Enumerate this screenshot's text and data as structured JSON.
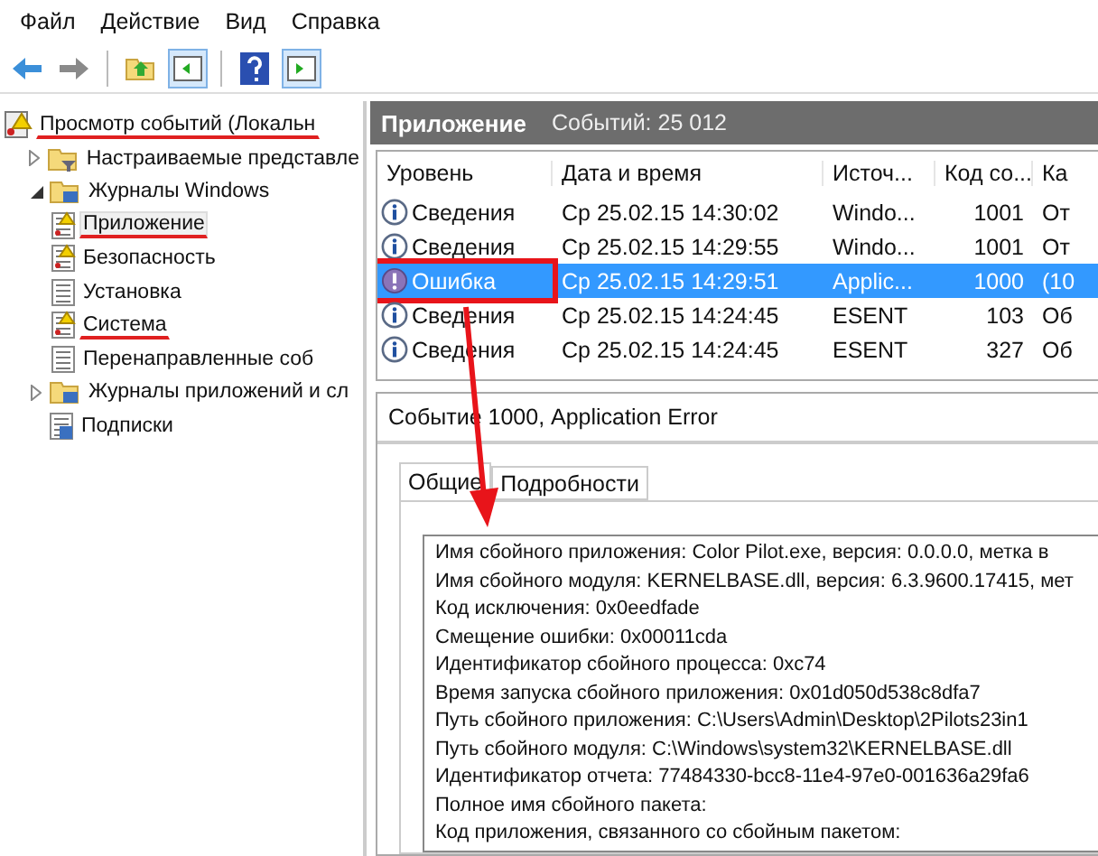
{
  "menu": [
    "Файл",
    "Действие",
    "Вид",
    "Справка"
  ],
  "tree": {
    "label": "Просмотр событий (Локальн",
    "underlined": true,
    "children": [
      {
        "label": "Настраиваемые представле",
        "kind": "filter-folder",
        "expanded": false
      },
      {
        "label": "Журналы Windows",
        "kind": "folder",
        "expanded": true,
        "children": [
          {
            "label": "Приложение",
            "kind": "log",
            "selected": true,
            "underlined": true
          },
          {
            "label": "Безопасность",
            "kind": "log",
            "selected": false,
            "underlined": false
          },
          {
            "label": "Установка",
            "kind": "plain",
            "selected": false,
            "underlined": false
          },
          {
            "label": "Система",
            "kind": "log",
            "selected": false,
            "underlined": true
          },
          {
            "label": "Перенаправленные соб",
            "kind": "plain",
            "selected": false,
            "underlined": false
          }
        ]
      },
      {
        "label": "Журналы приложений и сл",
        "kind": "folder",
        "expanded": false
      },
      {
        "label": "Подписки",
        "kind": "subs"
      }
    ]
  },
  "header": {
    "title": "Приложение",
    "count": "Событий: 25 012"
  },
  "table": {
    "columns": [
      "Уровень",
      "Дата и время",
      "Источ...",
      "Код со...",
      "Ка"
    ],
    "rows": [
      {
        "kind": "info",
        "level": "Сведения",
        "date": "Ср 25.02.15 14:30:02",
        "source": "Windo...",
        "code": "1001",
        "column_5": "От",
        "selected": false,
        "boxed": false
      },
      {
        "kind": "info",
        "level": "Сведения",
        "date": "Ср 25.02.15 14:29:55",
        "source": "Windo...",
        "code": "1001",
        "column_5": "От",
        "selected": false,
        "boxed": false
      },
      {
        "kind": "error",
        "level": "Ошибка",
        "date": "Ср 25.02.15 14:29:51",
        "source": "Applic...",
        "code": "1000",
        "column_5": "(10",
        "selected": true,
        "boxed": true
      },
      {
        "kind": "info",
        "level": "Сведения",
        "date": "Ср 25.02.15 14:24:45",
        "source": "ESENT",
        "code": "103",
        "column_5": "Об",
        "selected": false,
        "boxed": false
      },
      {
        "kind": "info",
        "level": "Сведения",
        "date": "Ср 25.02.15 14:24:45",
        "source": "ESENT",
        "code": "327",
        "column_5": "Об",
        "selected": false,
        "boxed": false
      }
    ]
  },
  "details": {
    "title": "Событие 1000, Application Error",
    "tabs": [
      {
        "label": "Общие",
        "selected": true
      },
      {
        "label": "Подробности",
        "selected": false
      }
    ],
    "lines": [
      {
        "text": "Имя сбойного приложения: Color Pilot.exe, версия: 0.0.0.0, метка в"
      },
      {
        "text": "Имя сбойного модуля: KERNELBASE.dll, версия: 6.3.9600.17415, мет"
      },
      {
        "text": "Код исключения: 0x0eedfade"
      },
      {
        "text": "Смещение ошибки: 0x00011cda"
      },
      {
        "text": "Идентификатор сбойного процесса: 0xc74"
      },
      {
        "text": "Время запуска сбойного приложения: 0x01d050d538c8dfa7"
      },
      {
        "text": "Путь сбойного приложения: C:\\Users\\Admin\\Desktop\\2Pilots23in1"
      },
      {
        "text": "Путь сбойного модуля: C:\\Windows\\system32\\KERNELBASE.dll"
      },
      {
        "text": "Идентификатор отчета: 77484330-bcc8-11e4-97e0-001636a29fa6"
      },
      {
        "text": "Полное имя сбойного пакета:"
      },
      {
        "text": "Код приложения, связанного со сбойным пакетом:"
      }
    ]
  }
}
